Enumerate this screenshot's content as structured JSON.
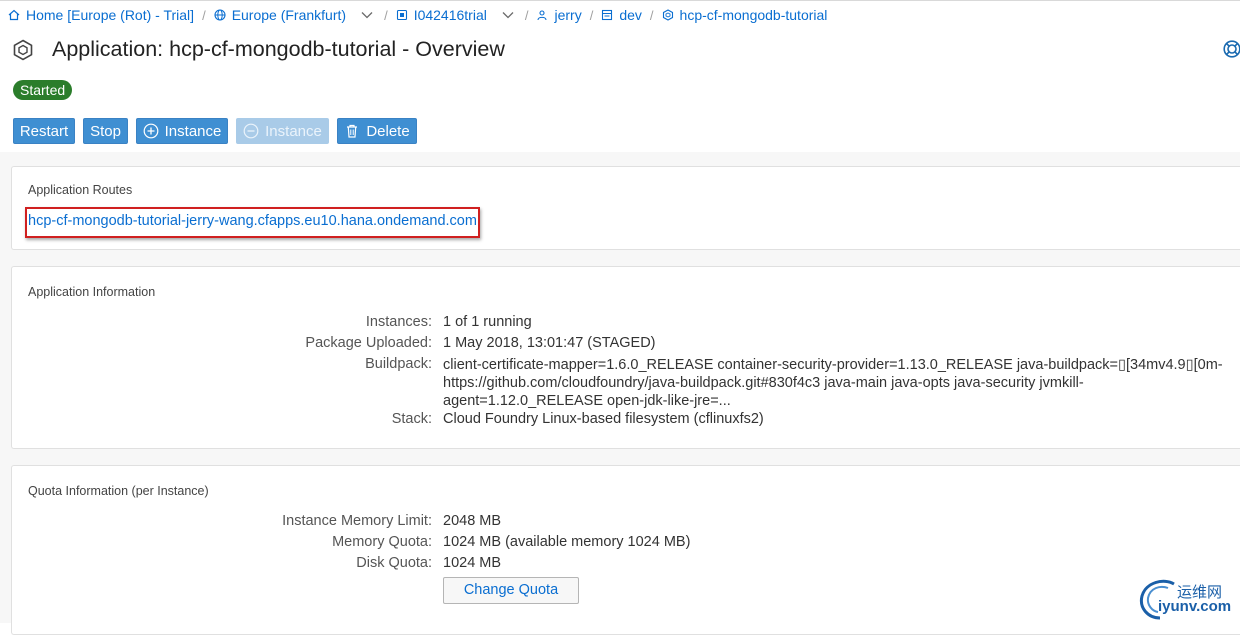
{
  "breadcrumb": {
    "home": "Home [Europe (Rot) - Trial]",
    "region": "Europe (Frankfurt)",
    "account": "I042416trial",
    "org": "jerry",
    "space": "dev",
    "app": "hcp-cf-mongodb-tutorial"
  },
  "title": "Application: hcp-cf-mongodb-tutorial - Overview",
  "status": "Started",
  "actions": {
    "restart": "Restart",
    "stop": "Stop",
    "add_instance": "Instance",
    "remove_instance": "Instance",
    "delete": "Delete"
  },
  "routes": {
    "title": "Application Routes",
    "url": "hcp-cf-mongodb-tutorial-jerry-wang.cfapps.eu10.hana.ondemand.com"
  },
  "info": {
    "title": "Application Information",
    "instances_label": "Instances:",
    "instances_value": "1 of 1 running",
    "package_label": "Package Uploaded:",
    "package_value": "1 May 2018, 13:01:47 (STAGED)",
    "buildpack_label": "Buildpack:",
    "buildpack_value": "client-certificate-mapper=1.6.0_RELEASE container-security-provider=1.13.0_RELEASE java-buildpack=▯[34mv4.9▯[0m-https://github.com/cloudfoundry/java-buildpack.git#830f4c3 java-main java-opts java-security jvmkill-agent=1.12.0_RELEASE open-jdk-like-jre=...",
    "stack_label": "Stack:",
    "stack_value": "Cloud Foundry Linux-based filesystem (cflinuxfs2)"
  },
  "quota": {
    "title": "Quota Information (per Instance)",
    "mem_limit_label": "Instance Memory Limit:",
    "mem_limit_value": "2048 MB",
    "mem_quota_label": "Memory Quota:",
    "mem_quota_value": "1024 MB (available memory 1024 MB)",
    "disk_label": "Disk Quota:",
    "disk_value": "1024 MB",
    "change_button": "Change Quota"
  },
  "watermark": {
    "top": "运维网",
    "bottom": "iyunv.com"
  },
  "colors": {
    "link": "#0a6ed1",
    "button": "#3f8fd2",
    "status_ok": "#2b7d2b",
    "highlight": "#d02020"
  }
}
